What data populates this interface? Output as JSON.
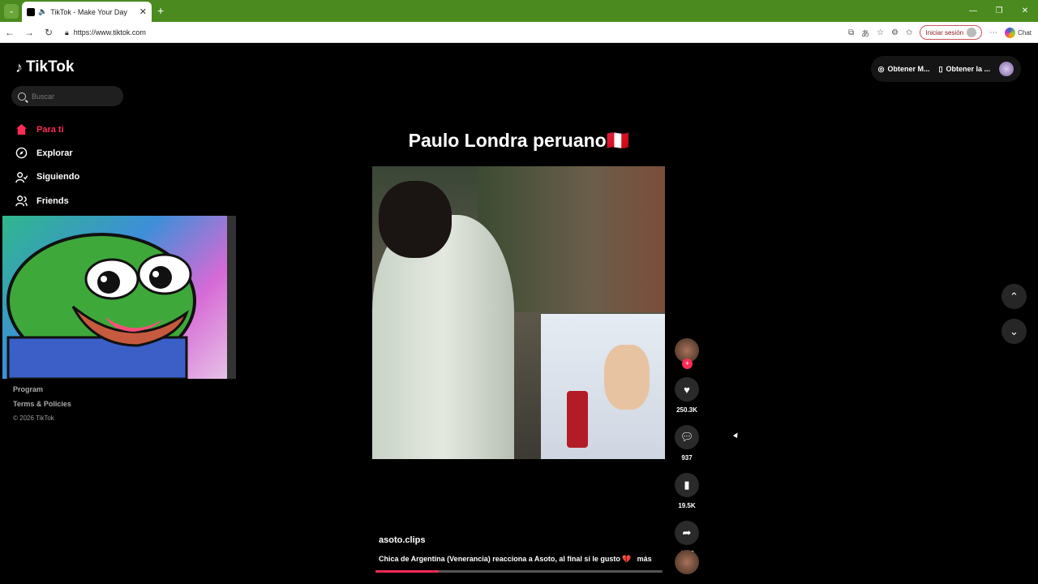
{
  "browser": {
    "tab_title": "TikTok - Make Your Day",
    "url": "https://www.tiktok.com",
    "signin_label": "Iniciar sesión",
    "chat_label": "Chat"
  },
  "brand": {
    "name": "TikTok",
    "accent": "#fe2c55"
  },
  "search": {
    "placeholder": "Buscar"
  },
  "sidebar": {
    "items": [
      {
        "label": "Para ti",
        "icon": "home-icon"
      },
      {
        "label": "Explorar",
        "icon": "compass-icon"
      },
      {
        "label": "Siguiendo",
        "icon": "user-follow-icon"
      },
      {
        "label": "Friends",
        "icon": "friends-icon"
      }
    ]
  },
  "footer": {
    "program": "Program",
    "terms": "Terms & Policies",
    "copyright": "© 2026 TikTok"
  },
  "topright": {
    "coins_label": "Obtener M...",
    "app_label": "Obtener la ..."
  },
  "video": {
    "title": "Paulo Londra peruano🇵🇪",
    "username": "asoto.clips",
    "description": "Chica de Argentina (Venerancia) reacciona a Asoto, al final si le gusto 💔",
    "more_label": "más",
    "progress": 0.22,
    "likes": "250.3K",
    "comments": "937",
    "saves": "19.5K",
    "shares": "4569"
  }
}
